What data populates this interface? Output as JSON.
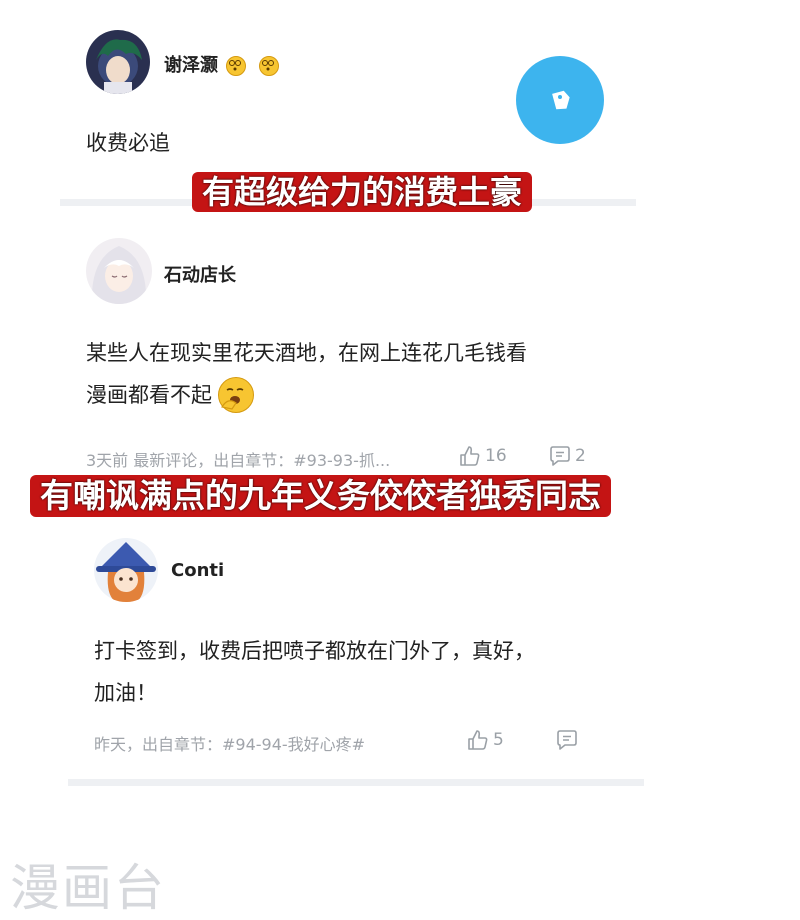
{
  "comments": [
    {
      "username": "谢泽灏",
      "text_lines": [
        "收费必追"
      ]
    },
    {
      "username": "石动店长",
      "text_lines": [
        "某些人在现实里花天酒地，在网上连花几毛钱看",
        "漫画都看不起"
      ],
      "meta": "3天前 最新评论，出自章节：#93-93-抓...",
      "likes": "16",
      "replies": "2"
    },
    {
      "username": "Conti",
      "text_lines": [
        "打卡签到，收费后把喷子都放在门外了，真好，",
        "加油！"
      ],
      "meta": "昨天，出自章节：#94-94-我好心疼#",
      "likes": "5",
      "replies": ""
    }
  ],
  "captions": {
    "top": "有超级给力的消费土豪",
    "middle": "有嘲讽满点的九年义务佼佼者独秀同志"
  },
  "watermark": "漫画台",
  "colors": {
    "caption_bg": "#c41414",
    "fab": "#3db4ee",
    "meta_text": "#a0a4aa"
  },
  "icons": [
    "thumbs-up-icon",
    "comment-icon",
    "edit-fab-icon",
    "dizzy-emoji-icon",
    "yawn-emoji-icon"
  ]
}
